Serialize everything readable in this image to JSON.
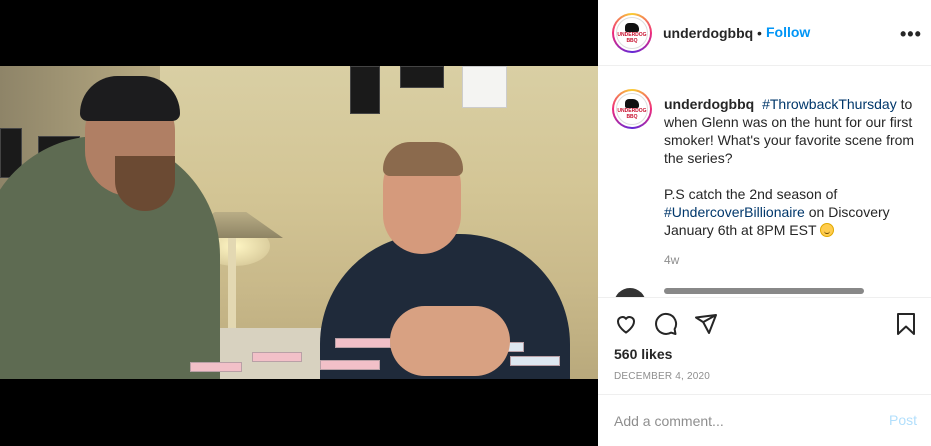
{
  "media": {
    "poster_lettering": [
      "UNDERDOG",
      "BBQ"
    ]
  },
  "header": {
    "username": "underdogbbq",
    "separator": "•",
    "follow_label": "Follow",
    "more_label": "•••"
  },
  "brand": {
    "logo_text_1": "UNDERDOG",
    "logo_text_2": "BBQ",
    "accent_color": "#c8102e"
  },
  "caption": {
    "username": "underdogbbq",
    "hashtag1": "#ThrowbackThursday",
    "text1": "to when Glenn was on the hunt for our first smoker! What's your favorite scene from the series?",
    "text2_pre": "P.S catch the 2nd season of",
    "hashtag2": "#UndercoverBillionaire",
    "text2_post": "on Discovery January 6th at 8PM EST",
    "emoji": "slightly-smiling-face",
    "age": "4w"
  },
  "actions": {
    "like_icon": "heart-icon",
    "comment_icon": "comment-icon",
    "share_icon": "share-icon",
    "save_icon": "bookmark-icon",
    "likes": "560 likes",
    "date": "DECEMBER 4, 2020"
  },
  "comment_box": {
    "placeholder": "Add a comment...",
    "post_label": "Post"
  },
  "colors": {
    "link": "#0095f6",
    "hashtag": "#00376b",
    "muted": "#8e8e8e"
  }
}
